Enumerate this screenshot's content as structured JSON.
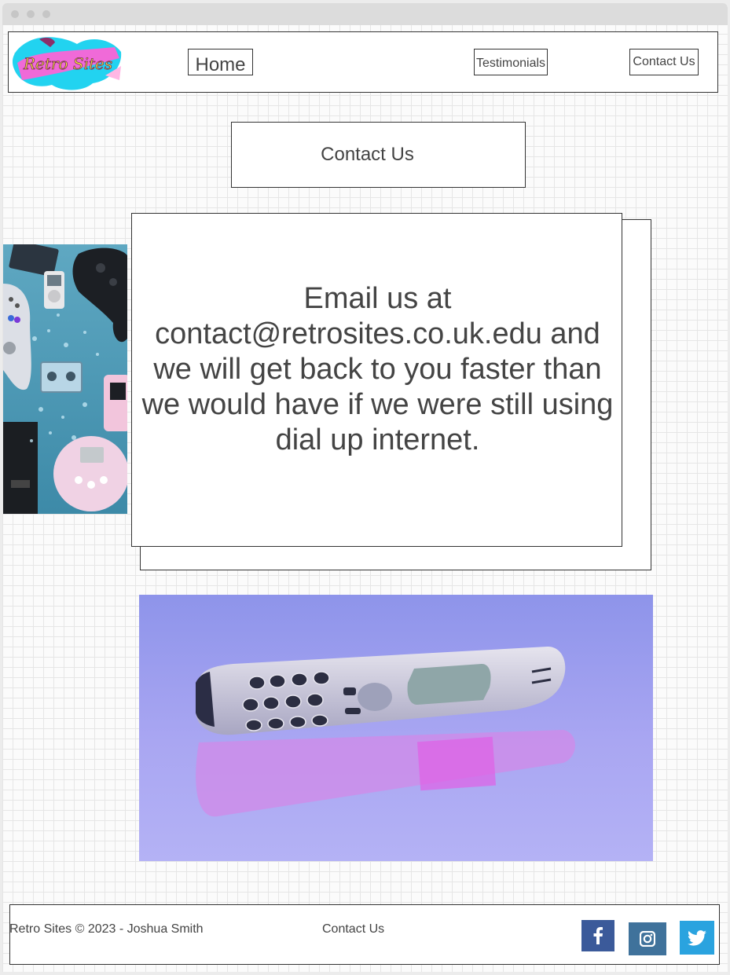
{
  "window": {
    "title": ""
  },
  "header": {
    "logo_text": "Retro Sites",
    "nav": {
      "home": "Home",
      "testimonials": "Testimonials",
      "contact": "Contact Us"
    }
  },
  "main": {
    "title": "Contact Us",
    "message": "Email us at contact@retrosites.co.uk.edu and we will get back to you faster than we would have if we were still using dial up internet."
  },
  "footer": {
    "copyright": "Retro Sites © 2023 - Joshua Smith",
    "contact_link": "Contact Us",
    "social": [
      "facebook-icon",
      "instagram-icon",
      "twitter-icon"
    ]
  },
  "colors": {
    "facebook": "#3b5a9a",
    "instagram": "#3f729b",
    "twitter": "#2aa3df",
    "text": "#444444",
    "border": "#333333"
  }
}
